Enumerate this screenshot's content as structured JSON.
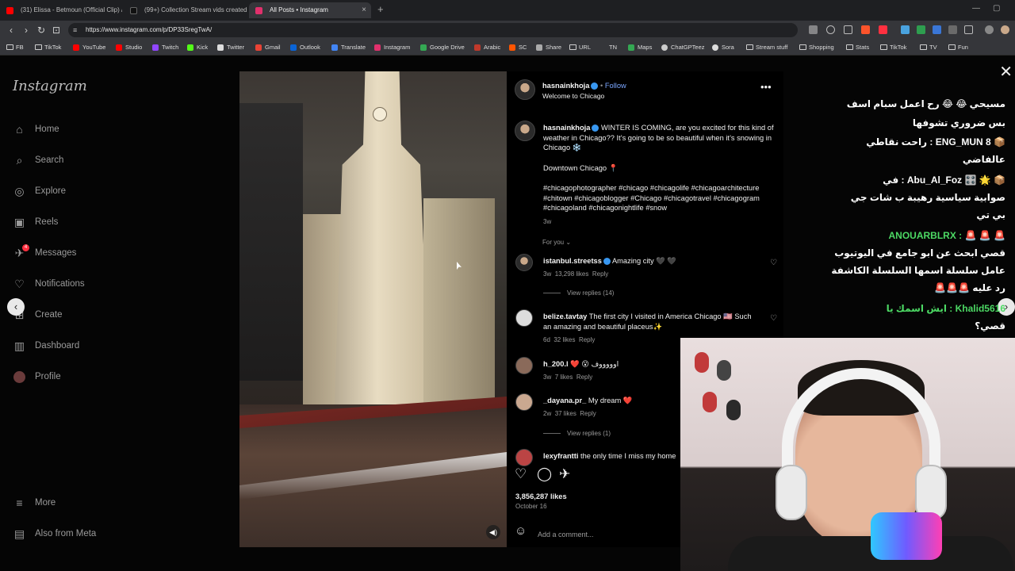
{
  "browser": {
    "tabs": [
      {
        "title": "(31) Elissa - Betmoun (Official Clip) /",
        "color": "#ff0000"
      },
      {
        "title": "(99+) Collection Stream vids created",
        "color": "#111111"
      },
      {
        "title": "All Posts • Instagram",
        "color": "#e1306c"
      }
    ],
    "url": "https://www.instagram.com/p/DP33SregTwA/",
    "bookmarks": [
      "FB",
      "TikTok",
      "YouTube",
      "Studio",
      "Twitch",
      "Kick",
      "Twitter",
      "Gmail",
      "Outlook",
      "Translate",
      "Instagram",
      "Google Drive",
      "Arabic",
      "SC",
      "Share",
      "URL",
      "TN",
      "Maps",
      "ChatGPTeez",
      "Sora",
      "Stream stuff",
      "Shopping",
      "Stats",
      "TikTok",
      "TV",
      "Fun"
    ]
  },
  "sidebar": {
    "logo": "Instagram",
    "items": [
      {
        "label": "Home",
        "icon": "home-icon",
        "glyph": "⌂"
      },
      {
        "label": "Search",
        "icon": "search-icon",
        "glyph": "⌕"
      },
      {
        "label": "Explore",
        "icon": "compass-icon",
        "glyph": "◎"
      },
      {
        "label": "Reels",
        "icon": "reels-icon",
        "glyph": "▣"
      },
      {
        "label": "Messages",
        "icon": "messenger-icon",
        "glyph": "✈",
        "badge": "4"
      },
      {
        "label": "Notifications",
        "icon": "heart-icon",
        "glyph": "♡"
      },
      {
        "label": "Create",
        "icon": "plus-icon",
        "glyph": "⊞"
      },
      {
        "label": "Dashboard",
        "icon": "dashboard-icon",
        "glyph": "▥"
      },
      {
        "label": "Profile",
        "icon": "avatar-icon",
        "glyph": ""
      }
    ],
    "more": "More",
    "meta": "Also from Meta"
  },
  "post": {
    "author": "hasnainkhoja",
    "follow": "Follow",
    "location": "Welcome to Chicago",
    "caption": "WINTER IS COMING, are you excited for this kind of weather in Chicago?? It’s going to be so beautiful when it’s snowing in Chicago ❄️",
    "caption2": "Downtown Chicago 📍",
    "hashtags": "#chicagophotographer #chicago #chicagolife #chicagoarchitecture #chitown #chicagoblogger #Chicago #chicagotravel #chicagogram #chicagoland #chicagonightlife #snow",
    "age": "3w",
    "for_you": "For you",
    "comments": [
      {
        "user": "istanbul.streetss",
        "verified": true,
        "text": "Amazing city 🖤 🖤",
        "age": "3w",
        "likes": "13,298 likes",
        "reply": "Reply",
        "view_replies": "View replies (14)"
      },
      {
        "user": "belize.tavtay",
        "verified": false,
        "text": "The first city I visited in America Chicago 🇺🇸 Such an amazing and beautiful placeus✨",
        "age": "6d",
        "likes": "32 likes",
        "reply": "Reply",
        "view_replies": ""
      },
      {
        "user": "h_200.l",
        "verified": false,
        "text": "❤️ 😮 اوووووف",
        "age": "3w",
        "likes": "7 likes",
        "reply": "Reply",
        "view_replies": ""
      },
      {
        "user": "_dayana.pr_",
        "verified": false,
        "text": "My dream ❤️",
        "age": "2w",
        "likes": "37 likes",
        "reply": "Reply",
        "view_replies": "View replies (1)"
      },
      {
        "user": "lexyfrantti",
        "verified": false,
        "text": "the only time I miss my home",
        "age": "",
        "likes": "",
        "reply": "",
        "view_replies": ""
      }
    ],
    "likes": "3,856,287 likes",
    "date": "October 16",
    "add_comment": "Add a comment..."
  },
  "stream_chat": [
    {
      "user": "",
      "text": "مسيحي 😂 😂 رح اعمل سبام اسف"
    },
    {
      "user": "",
      "text": "بس ضروري تشوفها"
    },
    {
      "user": "",
      "text": "راحت نقاطي : ENG_MUN 8 📦"
    },
    {
      "user": "",
      "text": "عالفاضي"
    },
    {
      "user": "",
      "text": "في : Abu_Al_Foz 🎛️ 🌟 📦"
    },
    {
      "user": "",
      "text": "صوابية سياسية رهيبة ب شات جي"
    },
    {
      "user": "",
      "text": "بي تي"
    },
    {
      "user": "",
      "text": "ANOUARBLRX : 🚨 🚨 🚨"
    },
    {
      "user": "",
      "text": "قصي ابحث عن ابو جامع في اليوتيوب"
    },
    {
      "user": "",
      "text": "عامل سلسلة اسمها السلسلة الكاشفة"
    },
    {
      "user": "",
      "text": "🚨🚨🚨 رد عليه"
    },
    {
      "user": "",
      "text": "ايش اسمك يا : Khalid5616"
    },
    {
      "user": "",
      "text": "قصي؟"
    }
  ],
  "colors": {
    "accent": "#3897f0",
    "badge": "#ff3040",
    "chat_green": "#4cd964",
    "chat_red": "#ff3b3b"
  }
}
